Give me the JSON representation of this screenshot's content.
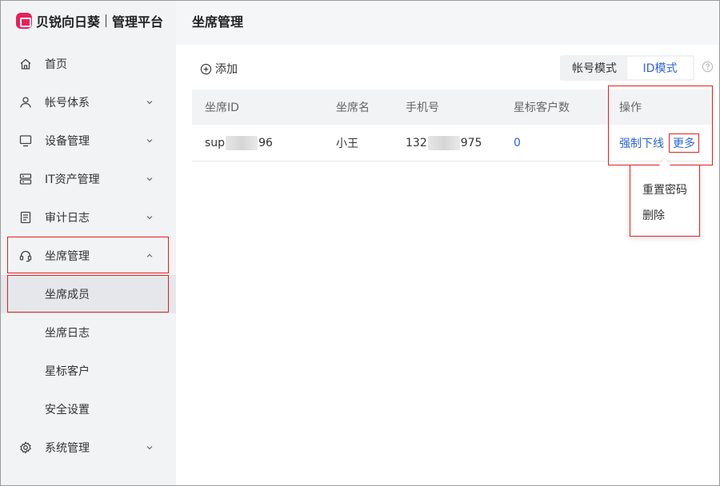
{
  "brand": {
    "name": "贝锐向日葵",
    "subtitle": "管理平台",
    "logo_color": "#e6215c"
  },
  "sidebar": {
    "items": [
      {
        "label": "首页",
        "icon": "home-icon",
        "expandable": false
      },
      {
        "label": "帐号体系",
        "icon": "user-icon",
        "expandable": true
      },
      {
        "label": "设备管理",
        "icon": "monitor-icon",
        "expandable": true
      },
      {
        "label": "IT资产管理",
        "icon": "server-icon",
        "expandable": true
      },
      {
        "label": "审计日志",
        "icon": "document-icon",
        "expandable": true
      },
      {
        "label": "坐席管理",
        "icon": "headset-icon",
        "expandable": true,
        "expanded": true
      }
    ],
    "sub_items": [
      {
        "label": "坐席成员",
        "active": true
      },
      {
        "label": "坐席日志"
      },
      {
        "label": "星标客户"
      },
      {
        "label": "安全设置"
      }
    ],
    "footer_item": {
      "label": "系统管理",
      "icon": "gear-icon",
      "expandable": true
    }
  },
  "header": {
    "title": "坐席管理"
  },
  "toolbar": {
    "add_label": "添加",
    "modes": [
      {
        "label": "帐号模式",
        "active": false
      },
      {
        "label": "ID模式",
        "active": true
      }
    ]
  },
  "table": {
    "columns": [
      "坐席ID",
      "坐席名",
      "手机号",
      "星标客户数",
      "操作"
    ],
    "rows": [
      {
        "id_prefix": "sup",
        "id_suffix": "96",
        "name": "小王",
        "phone_prefix": "132",
        "phone_suffix": "975",
        "star_count": "0",
        "actions": {
          "force_offline": "强制下线",
          "more": "更多"
        }
      }
    ]
  },
  "dropdown": {
    "items": [
      "重置密码",
      "删除"
    ]
  },
  "colors": {
    "accent": "#2c64e0",
    "highlight": "#dd2222",
    "sidebar_bg": "#f2f3f5"
  }
}
